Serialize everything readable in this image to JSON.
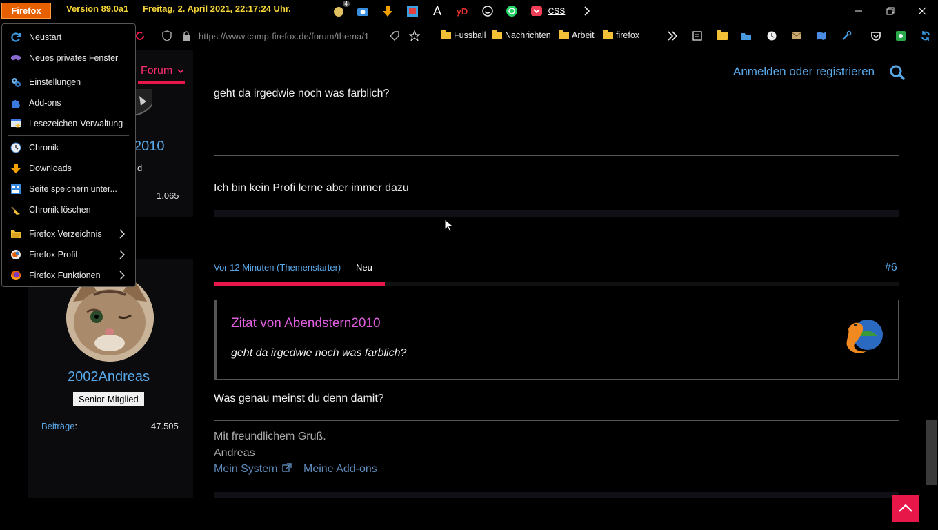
{
  "titlebar": {
    "firefox_button": "Firefox",
    "version": "Version 89.0a1",
    "datetime": "Freitag, 2. April 2021,  22:17:24 Uhr.",
    "badge_count": "4",
    "yd_label": "yD",
    "css_label": "CSS",
    "a_label": "A"
  },
  "navbar": {
    "url": "https://www.camp-firefox.de/forum/thema/1",
    "bookmarks": [
      "Fussball",
      "Nachrichten",
      "Arbeit",
      "firefox"
    ]
  },
  "app_menu": {
    "items": [
      {
        "label": "Neustart",
        "icon": "restart-icon"
      },
      {
        "label": "Neues privates Fenster",
        "icon": "private-window-icon"
      },
      {
        "label": "Einstellungen",
        "icon": "settings-icon"
      },
      {
        "label": "Add-ons",
        "icon": "addons-icon"
      },
      {
        "label": "Lesezeichen-Verwaltung",
        "icon": "bookmarks-manager-icon"
      },
      {
        "label": "Chronik",
        "icon": "history-icon"
      },
      {
        "label": "Downloads",
        "icon": "downloads-icon"
      },
      {
        "label": "Seite speichern unter...",
        "icon": "save-page-icon"
      },
      {
        "label": "Chronik löschen",
        "icon": "clear-history-icon"
      },
      {
        "label": "Firefox Verzeichnis",
        "icon": "folder-icon"
      },
      {
        "label": "Firefox Profil",
        "icon": "profile-icon"
      },
      {
        "label": "Firefox Funktionen",
        "icon": "firefox-icon"
      }
    ]
  },
  "page": {
    "nav_forum": "Forum",
    "login_link": "Anmelden oder registrieren",
    "user1": {
      "name_visible": "2010",
      "rank_visible": "d",
      "posts_value": "1.065"
    },
    "post1": {
      "text_top": "geht da irgedwie noch was farblich?",
      "signature": "Ich bin kein Profi lerne aber immer dazu"
    },
    "post2": {
      "time": "Vor 12 Minuten (Themenstarter)",
      "new_label": "Neu",
      "number": "#6",
      "progress": 0.25,
      "quote_title": "Zitat von Abendstern2010",
      "quote_text": "geht da irgedwie noch was farblich?",
      "reply": "Was genau meinst du denn damit?",
      "sig_greeting": "Mit freundlichem Gruß.",
      "sig_name": "Andreas",
      "sig_link1": "Mein System",
      "sig_link2": "Meine Add-ons"
    },
    "user2": {
      "name": "2002Andreas",
      "rank": "Senior-Mitglied",
      "posts_label": "Beiträge",
      "posts_colon": ":",
      "posts_value": "47.505"
    }
  },
  "colors": {
    "accent": "#e8174a",
    "link": "#59a8e8",
    "quote_title": "#e05fe0",
    "firefox_orange": "#e66000"
  }
}
